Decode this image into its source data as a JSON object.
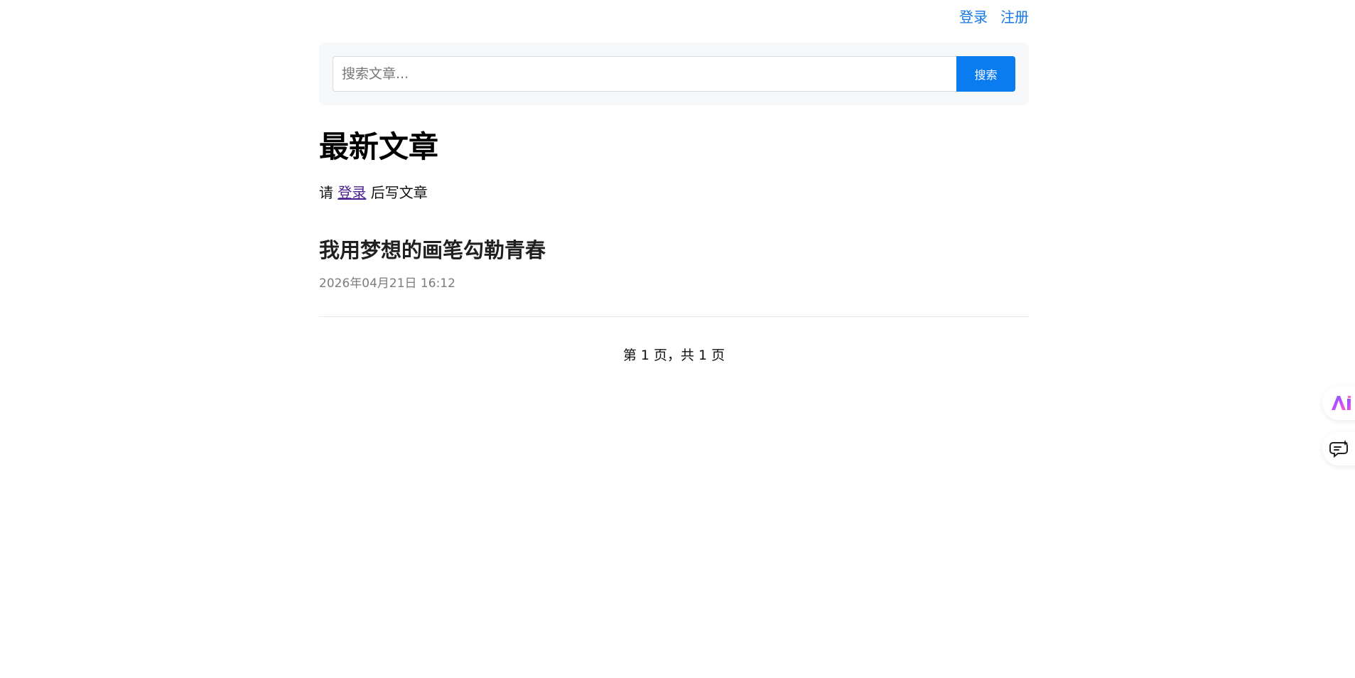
{
  "top_nav": {
    "login": "登录",
    "register": "注册"
  },
  "search": {
    "placeholder": "搜索文章...",
    "button_label": "搜索"
  },
  "main": {
    "title": "最新文章",
    "login_prompt_prefix": "请",
    "login_link": "登录",
    "login_prompt_suffix": "后写文章"
  },
  "articles": [
    {
      "title": "我用梦想的画笔勾勒青春",
      "date": "2026年04月21日 16:12"
    }
  ],
  "pagination": {
    "text": "第 1 页，共 1 页"
  },
  "side_widgets": {
    "ai_icon": "ai-logo-icon",
    "chat_icon": "chat-sparkle-icon"
  }
}
